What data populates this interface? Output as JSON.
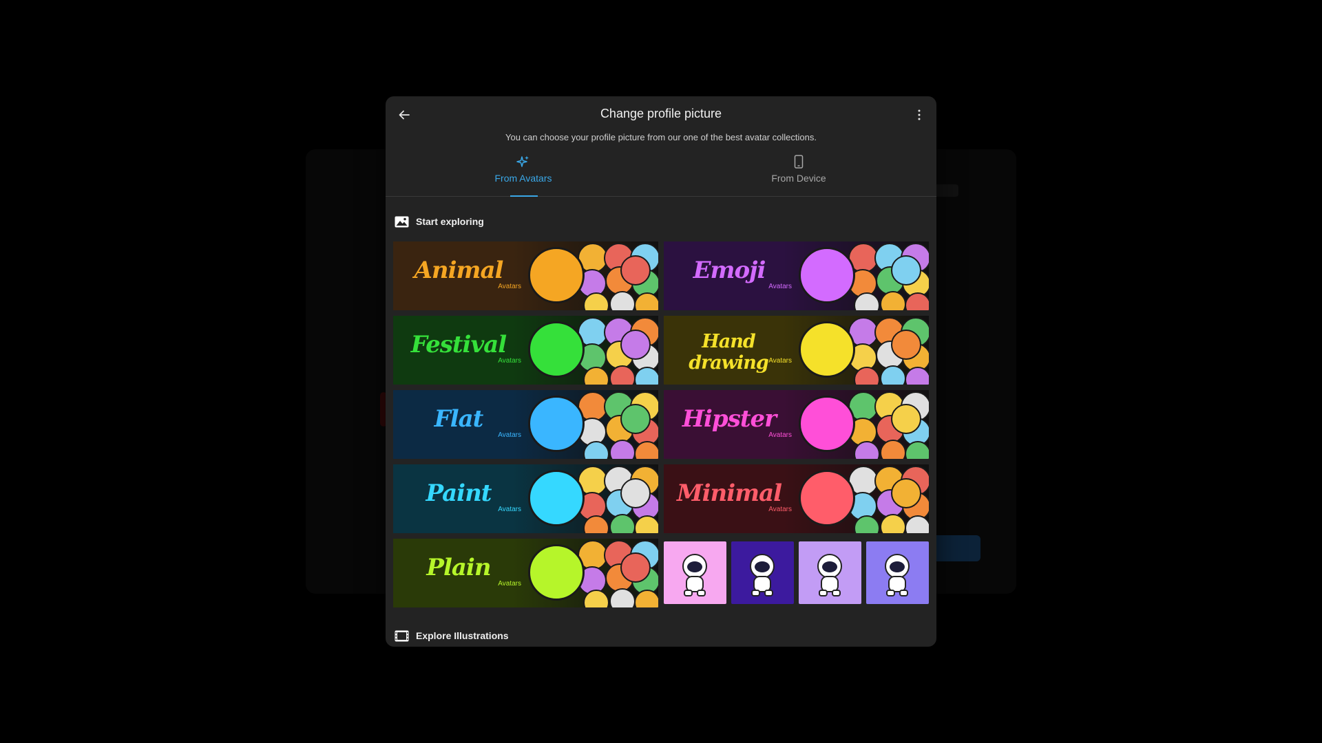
{
  "dialog": {
    "title": "Change profile picture",
    "subtitle": "You can choose your profile picture from our one of the best avatar collections."
  },
  "tabs": [
    {
      "label": "From Avatars",
      "icon": "sparkle-icon",
      "active": true
    },
    {
      "label": "From Device",
      "icon": "phone-icon",
      "active": false
    }
  ],
  "sections": {
    "start_exploring": "Start exploring",
    "explore_illustrations": "Explore Illustrations"
  },
  "collections": [
    {
      "name": "Animal",
      "sub": "Avatars",
      "accent": "#f5a623",
      "bg": "#3a2410"
    },
    {
      "name": "Emoji",
      "sub": "Avatars",
      "accent": "#d36bff",
      "bg": "#2b1140"
    },
    {
      "name": "Festival",
      "sub": "Avatars",
      "accent": "#35e03a",
      "bg": "#0f3a10"
    },
    {
      "name": "Hand drawing",
      "sub": "Avatars",
      "accent": "#f5e12a",
      "bg": "#3a3308"
    },
    {
      "name": "Flat",
      "sub": "Avatars",
      "accent": "#3ab6ff",
      "bg": "#0c2a44"
    },
    {
      "name": "Hipster",
      "sub": "Avatars",
      "accent": "#ff4fd8",
      "bg": "#3a0f34"
    },
    {
      "name": "Paint",
      "sub": "Avatars",
      "accent": "#35d8ff",
      "bg": "#0a3442"
    },
    {
      "name": "Minimal",
      "sub": "Avatars",
      "accent": "#ff5d6a",
      "bg": "#3a1015"
    },
    {
      "name": "Plain",
      "sub": "Avatars",
      "accent": "#b6f52a",
      "bg": "#2a3a08"
    }
  ],
  "astronaut_thumbs": [
    {
      "icon": "astronaut-peace-icon",
      "bg": "#f7a8f0"
    },
    {
      "icon": "astronaut-space-icon",
      "bg": "#3c1a9e"
    },
    {
      "icon": "astronaut-scooter-icon",
      "bg": "#c29cf5"
    },
    {
      "icon": "astronaut-moon-icon",
      "bg": "#8c7cf2"
    }
  ]
}
